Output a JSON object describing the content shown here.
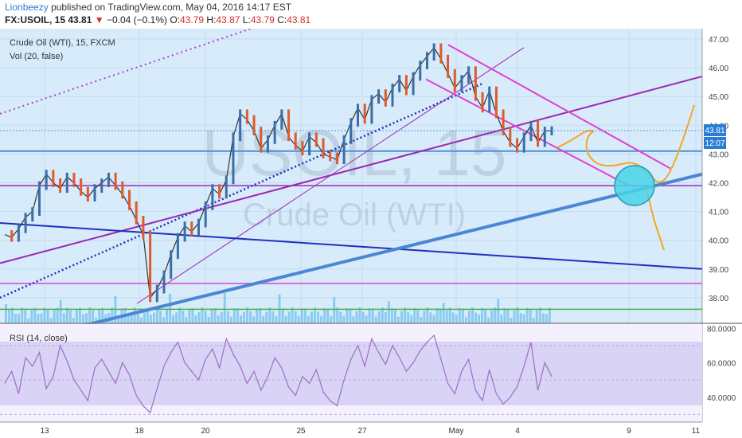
{
  "header": {
    "author": "Lionbeezy",
    "published": "published on TradingView.com, May 04, 2016 14:17 EST",
    "symbol": "FX:USOIL, 15",
    "last": "43.81",
    "change_arrow": "▼",
    "change": "−0.04 (−0.1%)",
    "o_label": "O:",
    "o_val": "43.79",
    "h_label": "H:",
    "h_val": "43.87",
    "l_label": "L:",
    "l_val": "43.79",
    "c_label": "C:",
    "c_val": "43.81"
  },
  "watermark": {
    "big": "USOIL, 15",
    "small": "Crude Oil (WTI)"
  },
  "legend": {
    "main": "Crude Oil (WTI), 15, FXCM",
    "vol": "Vol (20, false)",
    "rsi": "RSI (14, close)"
  },
  "price_badges": {
    "last": "43.81",
    "countdown": "12:07"
  },
  "colors": {
    "background": "#d7ebfb",
    "rsi_band": "#d9d3f5",
    "rsi_line": "#9b6fc6",
    "candle_up": "#3b6ea5",
    "candle_down": "#e05a2c",
    "magenta": "#e040d0",
    "purple": "#9c27b0",
    "blue": "#1e2fbf",
    "thick_blue": "#4a86d4",
    "orange": "#f5a623",
    "cyan": "#49d3e6",
    "volume": "#4ab3e8"
  },
  "chart_data": [
    {
      "type": "line",
      "title": "Crude Oil (WTI), 15, FXCM",
      "x_tick_labels": [
        "13",
        "18",
        "20",
        "25",
        "27",
        "May",
        "4",
        "9",
        "11"
      ],
      "y_ticks": [
        47.0,
        46.0,
        45.0,
        44.0,
        43.0,
        42.0,
        41.0,
        40.0,
        39.0,
        38.0
      ],
      "ylim": [
        37.2,
        47.2
      ],
      "series": [
        {
          "values": [
            40.2,
            40.1,
            40.4,
            40.8,
            41.0,
            41.9,
            42.3,
            42.0,
            41.8,
            42.2,
            42.0,
            41.7,
            41.5,
            41.8,
            42.0,
            42.2,
            41.9,
            41.6,
            41.2,
            40.7,
            40.2,
            38.0,
            38.3,
            38.8,
            39.5,
            40.1,
            40.5,
            40.3,
            40.6,
            41.2,
            41.8,
            41.6,
            42.1,
            43.6,
            44.4,
            44.2,
            43.8,
            43.2,
            43.5,
            44.0,
            44.4,
            43.6,
            43.3,
            43.1,
            43.6,
            43.4,
            43.0,
            42.9,
            42.8,
            43.5,
            44.1,
            44.6,
            44.2,
            44.9,
            45.1,
            44.8,
            45.3,
            45.6,
            45.2,
            45.7,
            46.1,
            46.4,
            46.7,
            46.3,
            45.8,
            45.3,
            45.6,
            45.9,
            45.0,
            44.6,
            45.2,
            44.4,
            43.8,
            43.4,
            43.2,
            43.6,
            44.0,
            43.4,
            43.8,
            43.81
          ]
        }
      ],
      "horizontal_lines": [
        43.1,
        41.9,
        38.5,
        37.6
      ],
      "annotations": [
        "projected zig-zag path (orange)",
        "target circle (cyan)"
      ]
    },
    {
      "type": "line",
      "title": "RSI (14, close)",
      "y_tick_labels": [
        "80.0000",
        "60.0000",
        "40.0000"
      ],
      "ylim": [
        26,
        82
      ],
      "band": [
        30,
        70
      ],
      "series": [
        {
          "values": [
            48,
            55,
            42,
            63,
            58,
            66,
            45,
            52,
            70,
            61,
            50,
            44,
            38,
            57,
            62,
            55,
            48,
            60,
            53,
            41,
            35,
            31,
            45,
            58,
            66,
            72,
            60,
            55,
            50,
            62,
            68,
            57,
            74,
            65,
            58,
            48,
            55,
            44,
            52,
            63,
            57,
            46,
            41,
            52,
            48,
            56,
            43,
            38,
            35,
            50,
            62,
            70,
            58,
            74,
            66,
            59,
            70,
            63,
            55,
            60,
            67,
            72,
            76,
            62,
            48,
            42,
            55,
            62,
            44,
            38,
            56,
            42,
            36,
            40,
            46,
            58,
            72,
            44,
            60,
            52
          ]
        }
      ]
    }
  ]
}
